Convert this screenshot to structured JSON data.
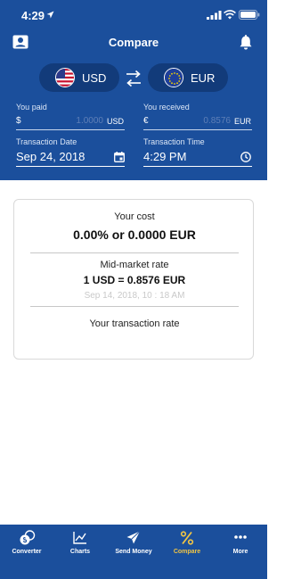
{
  "status": {
    "time": "4:29"
  },
  "header": {
    "title": "Compare"
  },
  "currencies": {
    "from": {
      "code": "USD"
    },
    "to": {
      "code": "EUR"
    }
  },
  "paid": {
    "label": "You paid",
    "symbol": "$",
    "placeholder": "1.0000",
    "unit": "USD"
  },
  "received": {
    "label": "You received",
    "symbol": "€",
    "placeholder": "0.8576",
    "unit": "EUR"
  },
  "date": {
    "label": "Transaction Date",
    "value": "Sep 24, 2018"
  },
  "time": {
    "label": "Transaction Time",
    "value": "4:29 PM"
  },
  "card": {
    "cost_label": "Your cost",
    "cost_value": "0.00% or 0.0000 EUR",
    "mid_label": "Mid-market rate",
    "mid_value": "1 USD = 0.8576 EUR",
    "mid_timestamp": "Sep 14, 2018, 10 : 18 AM",
    "rate_label": "Your transaction rate"
  },
  "tabs": [
    {
      "label": "Converter",
      "icon": "currency-converter-icon"
    },
    {
      "label": "Charts",
      "icon": "chart-line-icon"
    },
    {
      "label": "Send Money",
      "icon": "paper-plane-icon"
    },
    {
      "label": "Compare",
      "icon": "percent-icon",
      "active": true
    },
    {
      "label": "More",
      "icon": "more-dots-icon"
    }
  ],
  "colors": {
    "primary": "#1b4f9c",
    "pill": "#123b7a",
    "active_tab": "#f1c545"
  }
}
